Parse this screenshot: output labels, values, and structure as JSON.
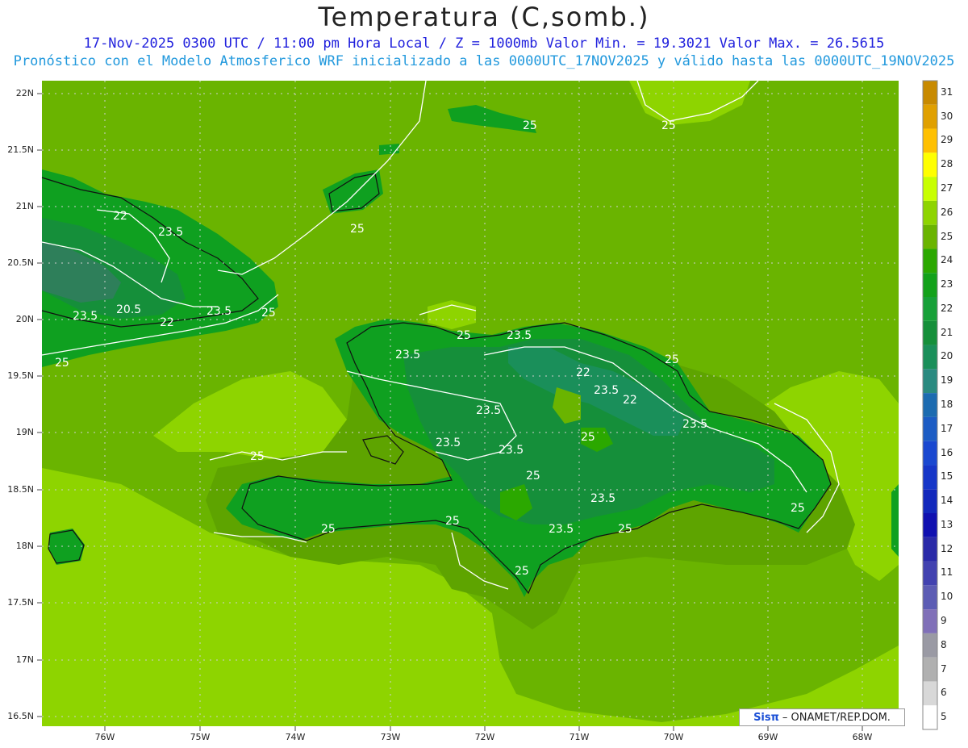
{
  "header": {
    "title": "Temperatura (C,somb.)",
    "line1": "17-Nov-2025 0300 UTC / 11:00 pm Hora Local / Z = 1000mb  Valor Min. = 19.3021  Valor Max. = 26.5615",
    "line2": "Pronóstico con el Modelo Atmosferico WRF inicializado a las 0000UTC_17NOV2025 y válido hasta las  0000UTC_19NOV2025"
  },
  "map": {
    "lat_labels": [
      "22N",
      "21.5N",
      "21N",
      "20.5N",
      "20N",
      "19.5N",
      "19N",
      "18.5N",
      "18N",
      "17.5N",
      "17N",
      "16.5N"
    ],
    "lon_labels": [
      "76W",
      "75W",
      "74W",
      "73W",
      "72W",
      "71W",
      "70W",
      "69W",
      "68W"
    ],
    "contour_labels": [
      "22",
      "23.5",
      "23.5",
      "20.5",
      "22",
      "23.5",
      "25",
      "25",
      "25",
      "25",
      "25",
      "23.5",
      "25",
      "23.5",
      "22",
      "23.5",
      "22",
      "25",
      "23.5",
      "23.5",
      "23.5",
      "25",
      "25",
      "23.5",
      "25",
      "25",
      "25",
      "23.5",
      "25",
      "23.5",
      "25",
      "25"
    ],
    "colors": {
      "sea_warm": "#8ed400",
      "sea": "#6ab400",
      "land_24": "#2ba800",
      "land_23": "#0fa020",
      "land_22": "#158f3a",
      "cold_21": "#2e7f5a"
    }
  },
  "colorbar": {
    "levels": [
      "31",
      "30",
      "29",
      "28",
      "27",
      "26",
      "25",
      "24",
      "23",
      "22",
      "21",
      "20",
      "19",
      "18",
      "17",
      "16",
      "15",
      "14",
      "13",
      "12",
      "11",
      "10",
      "9",
      "8",
      "7",
      "6",
      "5"
    ],
    "colors": [
      "#c88a00",
      "#e0a000",
      "#ffc000",
      "#ffff00",
      "#c8ff00",
      "#8ed400",
      "#6ab400",
      "#2ba800",
      "#13a11a",
      "#17a038",
      "#158f3a",
      "#1a8f5a",
      "#2a8a80",
      "#1c6bb0",
      "#1c5cc4",
      "#1a48d0",
      "#1636c8",
      "#1228bc",
      "#1010b0",
      "#2a2aa8",
      "#4242b0",
      "#5c5cb4",
      "#8070b8",
      "#9a9aa4",
      "#b0b0b0",
      "#d8d8d8",
      "#ffffff"
    ]
  },
  "credit": {
    "logo": "Sisπ",
    "text": "– ONAMET/REP.DOM."
  }
}
